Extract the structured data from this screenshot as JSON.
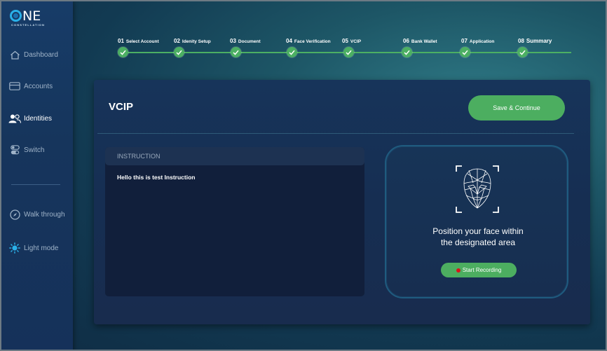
{
  "app": {
    "logo_text": "NE",
    "logo_sub": "CONSTELLATION"
  },
  "sidebar": {
    "items": [
      {
        "label": "Dashboard",
        "icon": "home-icon"
      },
      {
        "label": "Accounts",
        "icon": "accounts-icon"
      },
      {
        "label": "Identities",
        "icon": "users-icon"
      },
      {
        "label": "Switch",
        "icon": "switch-icon"
      },
      {
        "label": "Walk through",
        "icon": "compass-icon"
      },
      {
        "label": "Light mode",
        "icon": "sun-icon"
      }
    ],
    "active": "Identities"
  },
  "stepper": {
    "steps": [
      {
        "num": "01",
        "label": "Select Account"
      },
      {
        "num": "02",
        "label": "Idenity Setup"
      },
      {
        "num": "03",
        "label": "Document"
      },
      {
        "num": "04",
        "label": "Face Verification"
      },
      {
        "num": "05",
        "label": "VCIP"
      },
      {
        "num": "06",
        "label": "Bank Wallet"
      },
      {
        "num": "07",
        "label": "Application"
      },
      {
        "num": "08",
        "label": "Summary"
      }
    ]
  },
  "main": {
    "title": "VCIP",
    "save_label": "Save & Continue",
    "instruction": {
      "header": "INSTRUCTION",
      "body": "Hello this is test Instruction"
    },
    "face": {
      "line1": "Position your face within",
      "line2": "the designated area",
      "record_label": "Start Recording"
    }
  },
  "colors": {
    "accent": "#4cae60",
    "sidebar": "#16355c",
    "record_dot": "#d9141a"
  }
}
